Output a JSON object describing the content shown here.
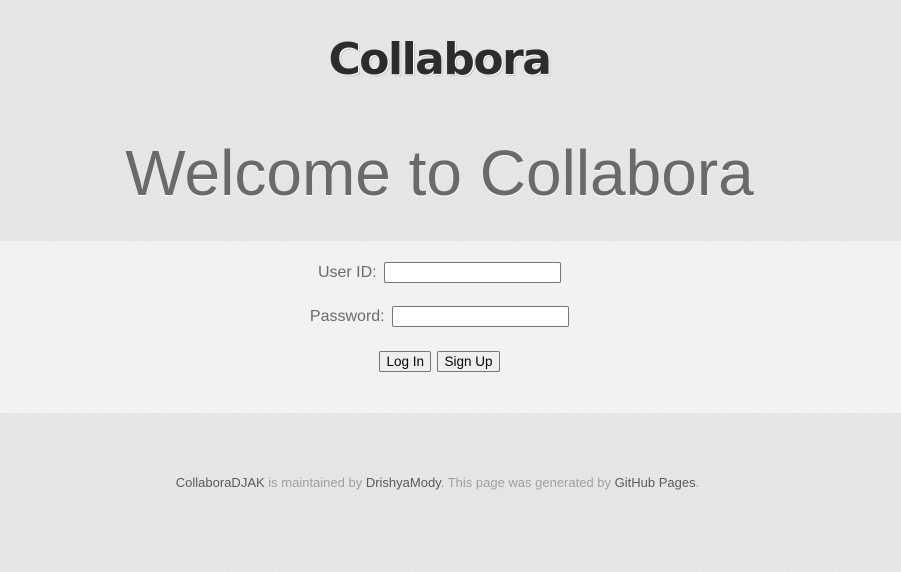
{
  "header": {
    "logo": "Collabora",
    "welcome": "Welcome to Collabora"
  },
  "login": {
    "user_id_label": "User ID:",
    "user_id_value": "",
    "password_label": "Password:",
    "password_value": "",
    "login_button": "Log In",
    "signup_button": "Sign Up"
  },
  "footer": {
    "project_link": "CollaboraDJAK",
    "text1": " is maintained by ",
    "author_link": "DrishyaMody",
    "text2": ". This page was generated by ",
    "github_link": "GitHub Pages",
    "text3": "."
  }
}
